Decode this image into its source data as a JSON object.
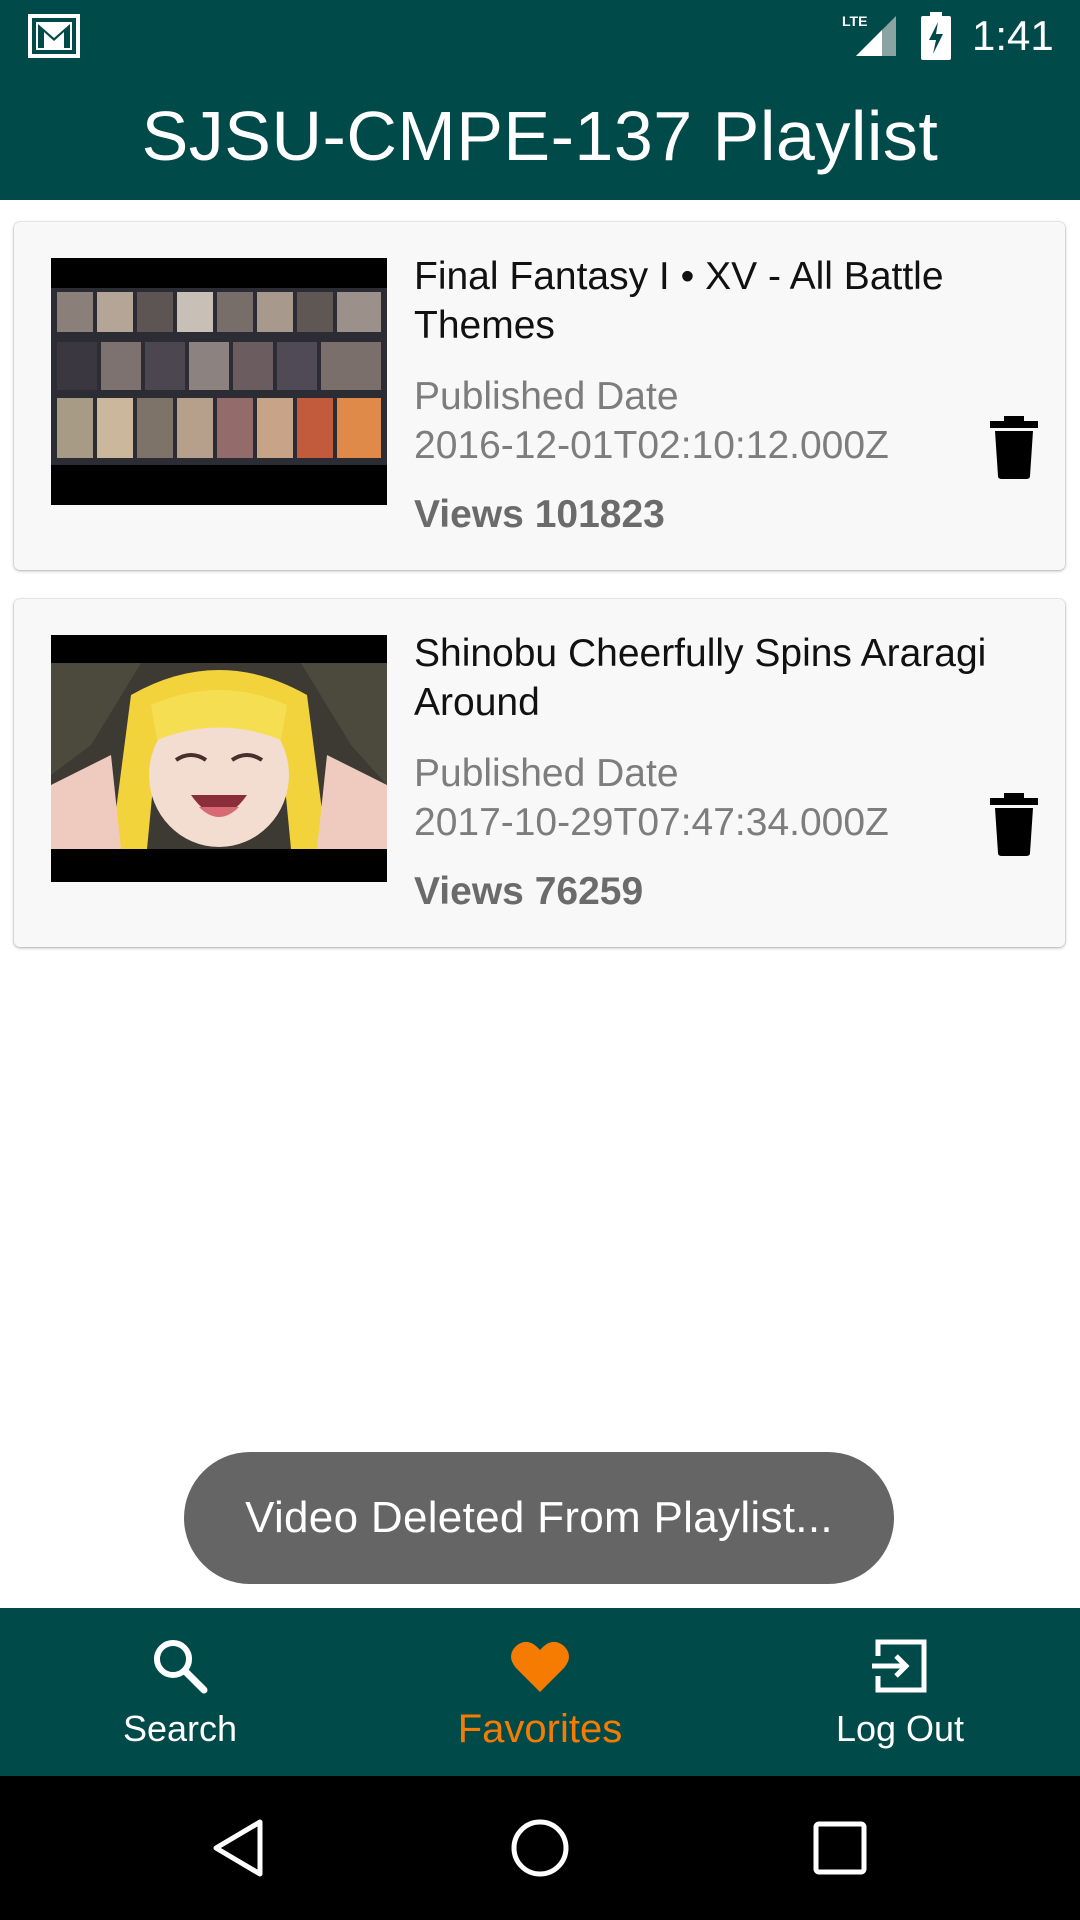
{
  "status_bar": {
    "time": "1:41",
    "network": "LTE",
    "icons": [
      "gmail-icon",
      "lte-signal-icon",
      "battery-charging-icon"
    ]
  },
  "app_bar": {
    "title": "SJSU-CMPE-137 Playlist"
  },
  "videos": [
    {
      "title": "Final Fantasy I • XV - All Battle Themes",
      "published_label": "Published Date",
      "published_date": "2016-12-01T02:10:12.000Z",
      "views_label": "Views",
      "views": "101823",
      "thumbnail": "final-fantasy-characters-collage",
      "delete_icon": "trash-icon"
    },
    {
      "title": "Shinobu Cheerfully Spins Araragi Around",
      "published_label": "Published Date",
      "published_date": "2017-10-29T07:47:34.000Z",
      "views_label": "Views",
      "views": "76259",
      "thumbnail": "anime-blonde-girl-laughing",
      "delete_icon": "trash-icon"
    }
  ],
  "toast": {
    "message": "Video Deleted From Playlist..."
  },
  "bottom_nav": {
    "items": [
      {
        "label": "Search",
        "icon": "search-icon",
        "active": false
      },
      {
        "label": "Favorites",
        "icon": "heart-icon",
        "active": true
      },
      {
        "label": "Log Out",
        "icon": "logout-icon",
        "active": false
      }
    ]
  },
  "system_nav": {
    "buttons": [
      "back-icon",
      "home-icon",
      "recents-icon"
    ]
  },
  "colors": {
    "primary": "#004a4a",
    "accent": "#f57c00",
    "toast_bg": "#656565",
    "card_bg": "#f8f8f8"
  }
}
